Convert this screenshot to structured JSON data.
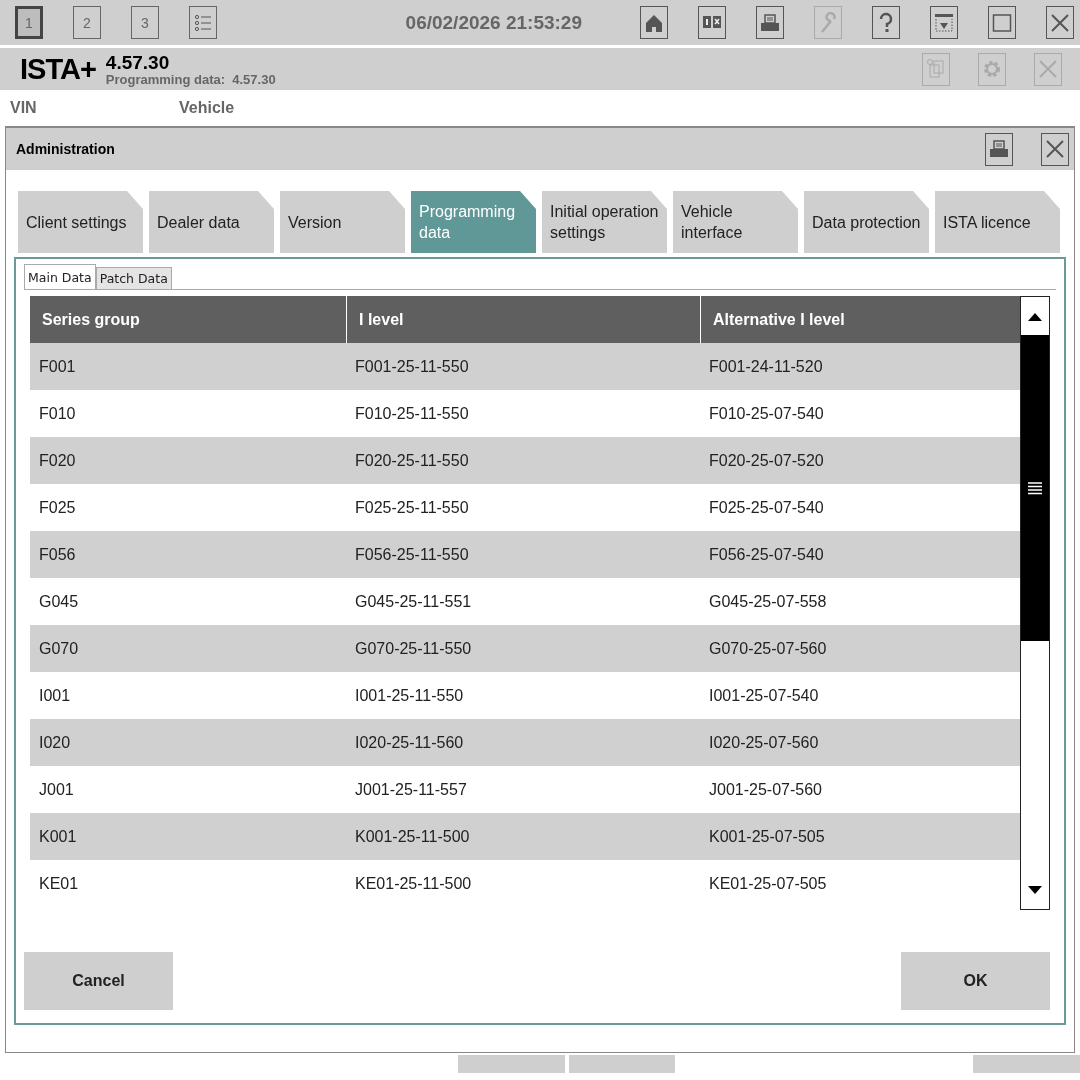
{
  "toolbar": {
    "buttons": [
      {
        "kind": "number",
        "label": "1",
        "selected": true,
        "disabled": false
      },
      {
        "kind": "number",
        "label": "2",
        "selected": false,
        "disabled": false
      },
      {
        "kind": "number",
        "label": "3",
        "selected": false,
        "disabled": false
      },
      {
        "kind": "list",
        "selected": false,
        "disabled": false
      }
    ],
    "datetime": "06/02/2026 21:53:29",
    "icons": [
      {
        "kind": "home",
        "disabled": false
      },
      {
        "kind": "compare",
        "disabled": false
      },
      {
        "kind": "printer",
        "disabled": false
      },
      {
        "kind": "wrench",
        "disabled": true
      },
      {
        "kind": "help",
        "disabled": false
      },
      {
        "kind": "download",
        "disabled": false
      },
      {
        "kind": "maximize",
        "disabled": false
      },
      {
        "kind": "close",
        "disabled": false
      }
    ]
  },
  "header": {
    "app": "ISTA+",
    "version": "4.57.30",
    "programming_label": "Programming data:",
    "programming_version": "4.57.30",
    "icons": [
      {
        "kind": "documents",
        "disabled": true
      },
      {
        "kind": "gear",
        "disabled": true
      },
      {
        "kind": "close",
        "disabled": true
      }
    ]
  },
  "vehicle_bar": {
    "vin_label": "VIN",
    "vehicle_label": "Vehicle"
  },
  "dialog": {
    "title": "Administration",
    "tabs": [
      {
        "label": "Client settings",
        "selected": false
      },
      {
        "label": "Dealer data",
        "selected": false
      },
      {
        "label": "Version",
        "selected": false
      },
      {
        "label": "Programming data",
        "selected": true
      },
      {
        "label": "Initial operation settings",
        "selected": false
      },
      {
        "label": "Vehicle interface",
        "selected": false
      },
      {
        "label": "Data protection",
        "selected": false
      },
      {
        "label": "ISTA licence",
        "selected": false
      }
    ],
    "subtabs": [
      {
        "label": "Main Data",
        "selected": true
      },
      {
        "label": "Patch Data",
        "selected": false
      }
    ],
    "table": {
      "columns": [
        "Series group",
        "I level",
        "Alternative I level"
      ],
      "rows": [
        [
          "F001",
          "F001-25-11-550",
          "F001-24-11-520"
        ],
        [
          "F010",
          "F010-25-11-550",
          "F010-25-07-540"
        ],
        [
          "F020",
          "F020-25-11-550",
          "F020-25-07-520"
        ],
        [
          "F025",
          "F025-25-11-550",
          "F025-25-07-540"
        ],
        [
          "F056",
          "F056-25-11-550",
          "F056-25-07-540"
        ],
        [
          "G045",
          "G045-25-11-551",
          "G045-25-07-558"
        ],
        [
          "G070",
          "G070-25-11-550",
          "G070-25-07-560"
        ],
        [
          "I001",
          "I001-25-11-550",
          "I001-25-07-540"
        ],
        [
          "I020",
          "I020-25-11-560",
          "I020-25-07-560"
        ],
        [
          "J001",
          "J001-25-11-557",
          "J001-25-07-560"
        ],
        [
          "K001",
          "K001-25-11-500",
          "K001-25-07-505"
        ],
        [
          "KE01",
          "KE01-25-11-500",
          "KE01-25-07-505"
        ]
      ]
    },
    "buttons": {
      "cancel": "Cancel",
      "ok": "OK"
    }
  }
}
